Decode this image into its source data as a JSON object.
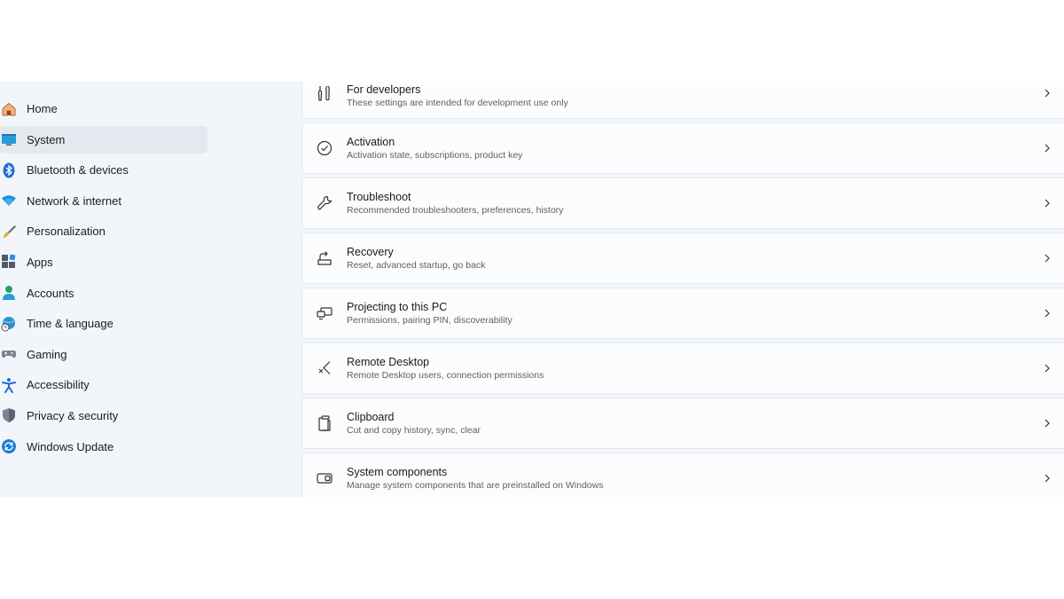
{
  "sidebar": {
    "items": [
      {
        "label": "Home",
        "icon": "home-icon"
      },
      {
        "label": "System",
        "icon": "system-icon",
        "selected": true
      },
      {
        "label": "Bluetooth & devices",
        "icon": "bluetooth-icon"
      },
      {
        "label": "Network & internet",
        "icon": "wifi-icon"
      },
      {
        "label": "Personalization",
        "icon": "brush-icon"
      },
      {
        "label": "Apps",
        "icon": "apps-icon"
      },
      {
        "label": "Accounts",
        "icon": "person-icon"
      },
      {
        "label": "Time & language",
        "icon": "globe-clock-icon"
      },
      {
        "label": "Gaming",
        "icon": "gamepad-icon"
      },
      {
        "label": "Accessibility",
        "icon": "accessibility-icon"
      },
      {
        "label": "Privacy & security",
        "icon": "shield-icon"
      },
      {
        "label": "Windows Update",
        "icon": "update-icon"
      }
    ]
  },
  "settings": {
    "items": [
      {
        "title": "For developers",
        "subtitle": "These settings are intended for development use only",
        "icon": "developer-tools-icon"
      },
      {
        "title": "Activation",
        "subtitle": "Activation state, subscriptions, product key",
        "icon": "check-circle-icon"
      },
      {
        "title": "Troubleshoot",
        "subtitle": "Recommended troubleshooters, preferences, history",
        "icon": "wrench-icon"
      },
      {
        "title": "Recovery",
        "subtitle": "Reset, advanced startup, go back",
        "icon": "recovery-icon"
      },
      {
        "title": "Projecting to this PC",
        "subtitle": "Permissions, pairing PIN, discoverability",
        "icon": "projecting-icon"
      },
      {
        "title": "Remote Desktop",
        "subtitle": "Remote Desktop users, connection permissions",
        "icon": "remote-desktop-icon"
      },
      {
        "title": "Clipboard",
        "subtitle": "Cut and copy history, sync, clear",
        "icon": "clipboard-icon"
      },
      {
        "title": "System components",
        "subtitle": "Manage system components that are preinstalled on Windows",
        "icon": "system-components-icon"
      }
    ]
  },
  "colors": {
    "window_bg": "#f2f6fb",
    "card_bg": "#fbfcfd",
    "selected_bg": "#e5e9ef",
    "accent": "#0067c0"
  }
}
